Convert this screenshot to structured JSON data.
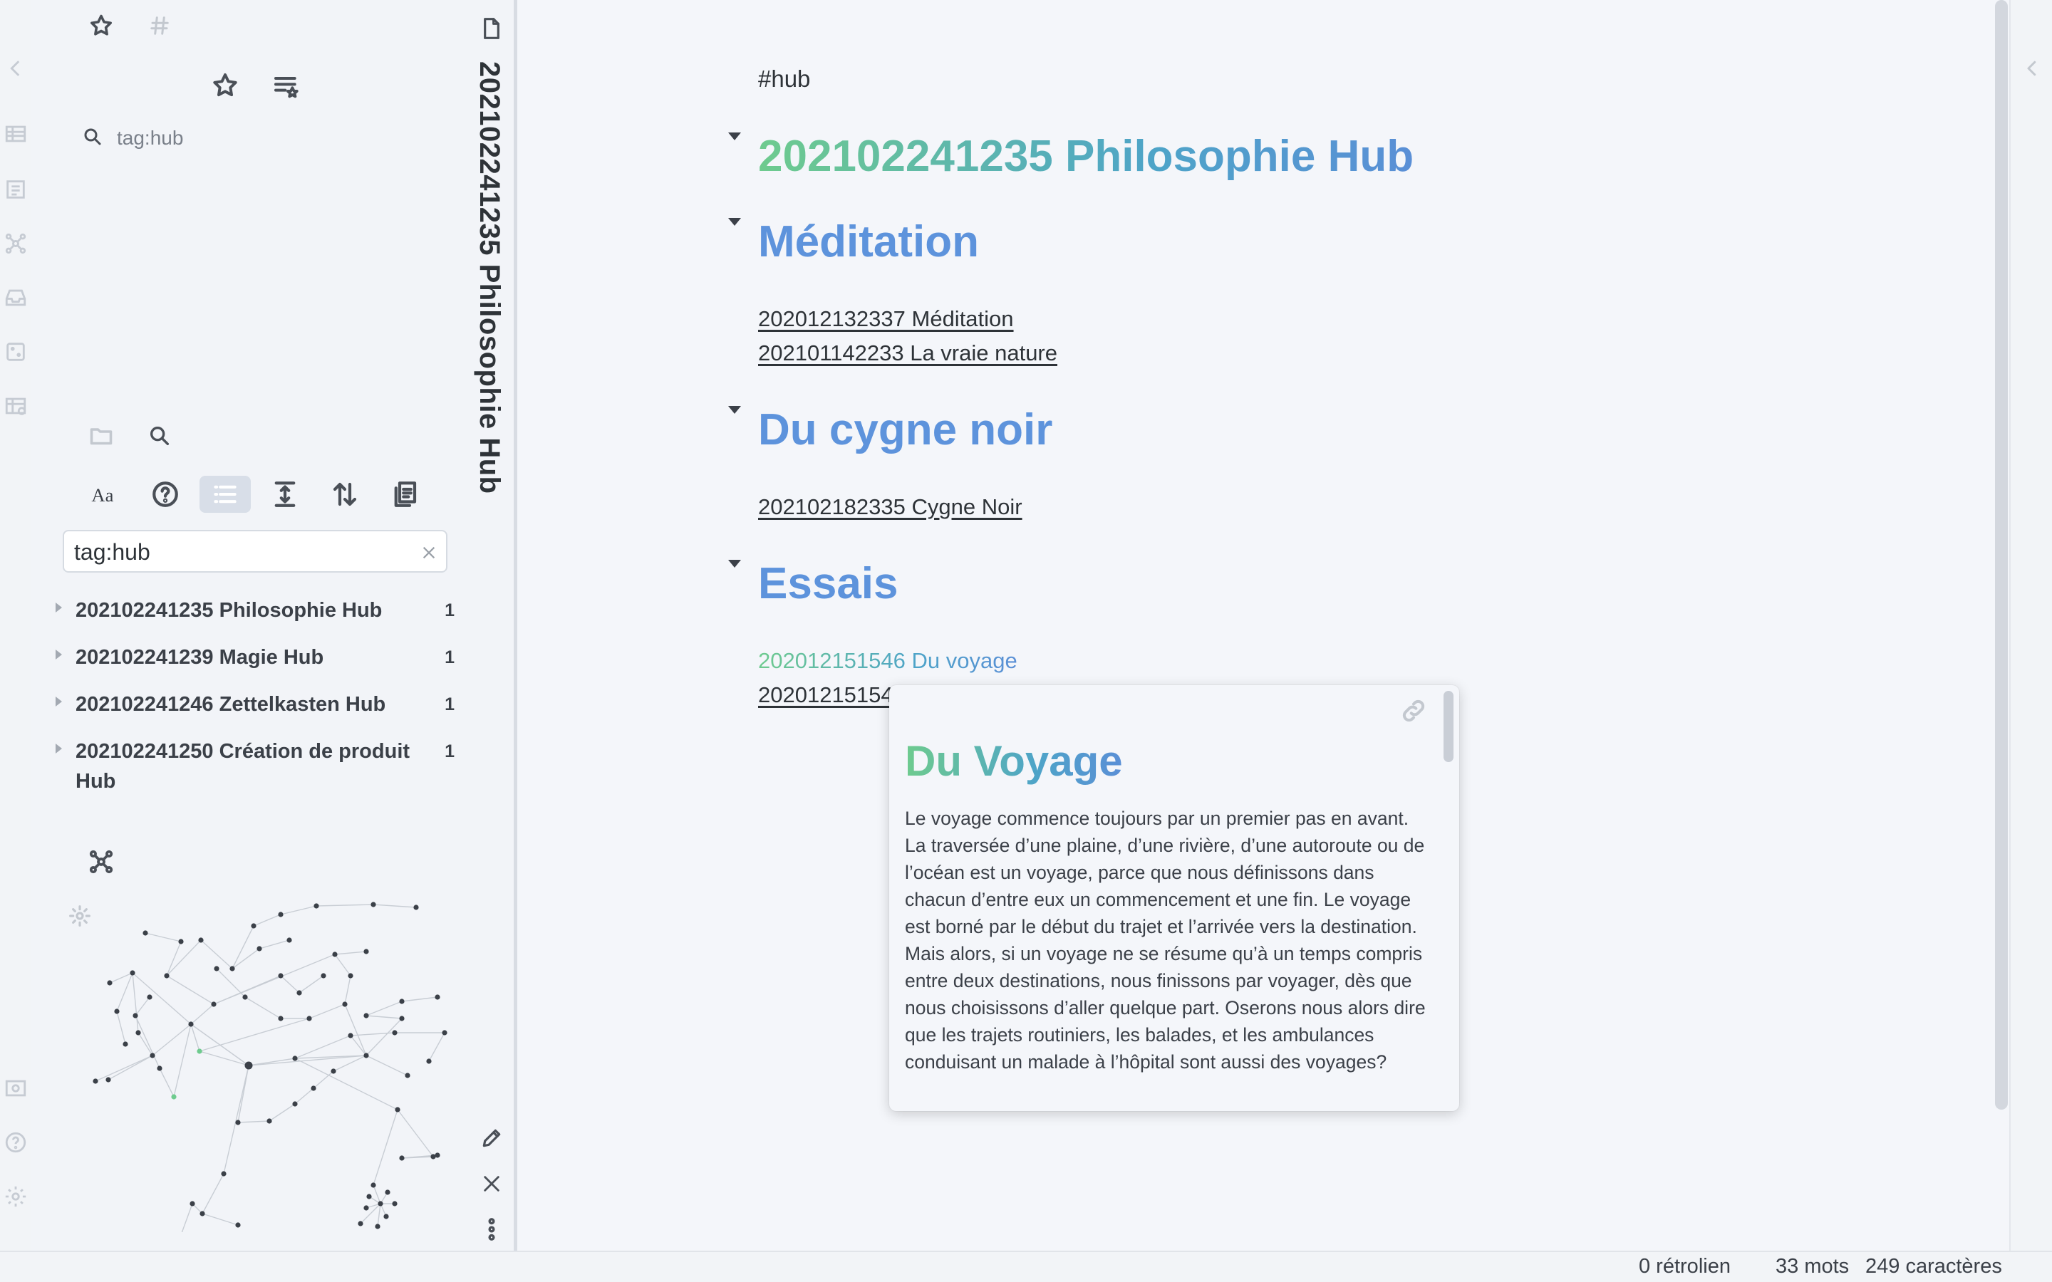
{
  "sidebar": {
    "search_query": "tag:hub",
    "search_input_value": "tag:hub",
    "results": [
      {
        "title": "202102241235 Philosophie Hub",
        "count": "1"
      },
      {
        "title": "202102241239 Magie Hub",
        "count": "1"
      },
      {
        "title": "202102241246 Zettelkasten Hub",
        "count": "1"
      },
      {
        "title": "202102241250 Création de produit Hub",
        "count": "1"
      }
    ],
    "toolbar_icons": [
      "match-case-icon",
      "explain-icon",
      "collapse-results-icon",
      "context-icon",
      "sort-icon",
      "copy-results-icon"
    ],
    "top_icons": [
      "star-icon",
      "tag-icon"
    ]
  },
  "side_pane": {
    "vertical_title": "202102241235 Philosophie Hub"
  },
  "note": {
    "tag": "#hub",
    "title": "202102241235 Philosophie Hub",
    "sections": [
      {
        "heading": "Méditation",
        "links": [
          "202012132337 Méditation",
          "202101142233 La vraie nature"
        ]
      },
      {
        "heading": "Du cygne noir",
        "links": [
          "202102182335 Cygne Noir"
        ]
      },
      {
        "heading": "Essais",
        "links": [
          "202012151546 Du voyage",
          "20201215154"
        ]
      }
    ]
  },
  "popover": {
    "title": "Du Voyage",
    "body": "Le voyage commence toujours par un premier pas en avant. La traversée d’une plaine, d’une rivière, d’une autoroute ou de l’océan est un voyage, parce que nous définissons dans chacun d’entre eux un commencement et une fin. Le voyage est borné par le début du trajet et l’arrivée vers la destination. Mais alors, si un voyage ne se résume qu’à un temps compris entre deux destinations, nous finissons par voyager, dès que nous choisissons d’aller quelque part. Oserons nous alors dire que les trajets routiniers, les balades, et les ambulances conduisant un malade à l’hôpital sont aussi des voyages?"
  },
  "status_bar": {
    "backlinks": "0 rétrolien",
    "words": "33 mots",
    "characters": "249 caractères"
  },
  "colors": {
    "accent_green": "#6ecb8e",
    "accent_blue": "#5d93dc",
    "background": "#f4f6fa"
  }
}
